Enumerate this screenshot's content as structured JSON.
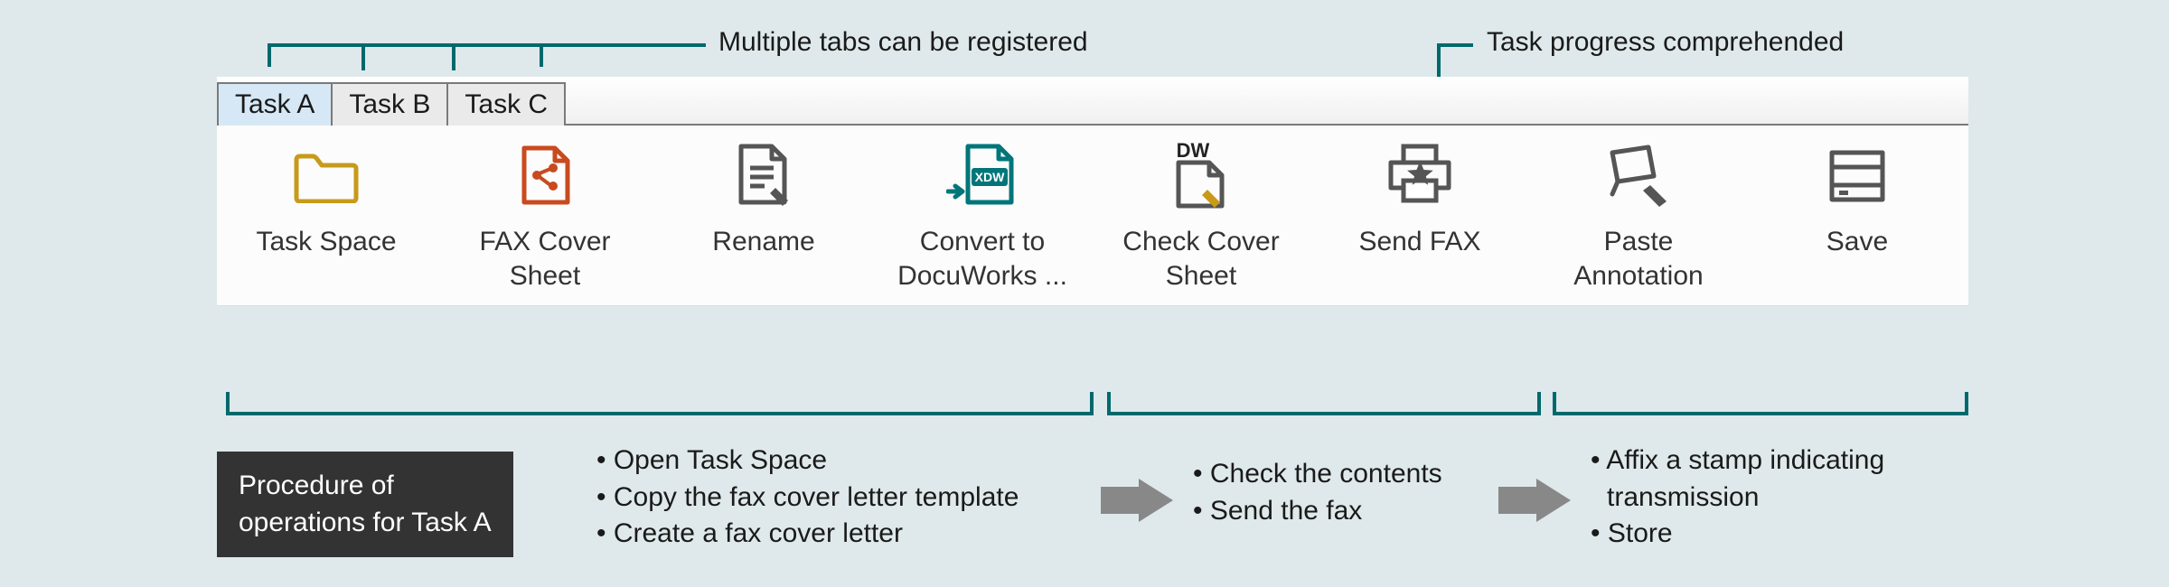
{
  "callouts": {
    "tabs": "Multiple tabs can be registered",
    "progress": "Task progress comprehended"
  },
  "tabs": [
    {
      "label": "Task A",
      "active": true
    },
    {
      "label": "Task B",
      "active": false
    },
    {
      "label": "Task C",
      "active": false
    }
  ],
  "toolbar_buttons": [
    {
      "name": "task-space",
      "label": "Task Space",
      "icon": "folder"
    },
    {
      "name": "fax-cover-sheet",
      "label": "FAX Cover Sheet",
      "icon": "share-page"
    },
    {
      "name": "rename",
      "label": "Rename",
      "icon": "page-edit"
    },
    {
      "name": "convert-docuworks",
      "label": "Convert to DocuWorks ...",
      "icon": "xdw"
    },
    {
      "name": "check-cover-sheet",
      "label": "Check Cover Sheet",
      "icon": "dw-page"
    },
    {
      "name": "send-fax",
      "label": "Send FAX",
      "icon": "printer"
    },
    {
      "name": "paste-annotation",
      "label": "Paste Annotation",
      "icon": "stamp"
    },
    {
      "name": "save",
      "label": "Save",
      "icon": "save"
    }
  ],
  "progress_badge": {
    "state": "complete"
  },
  "procedure_title_line1": "Procedure of",
  "procedure_title_line2": "operations for Task A",
  "steps": [
    [
      "Open Task Space",
      "Copy the fax cover letter template",
      "Create a fax cover letter"
    ],
    [
      "Check the contents",
      "Send the fax"
    ],
    [
      "Affix a stamp indicating transmission",
      "Store"
    ]
  ]
}
